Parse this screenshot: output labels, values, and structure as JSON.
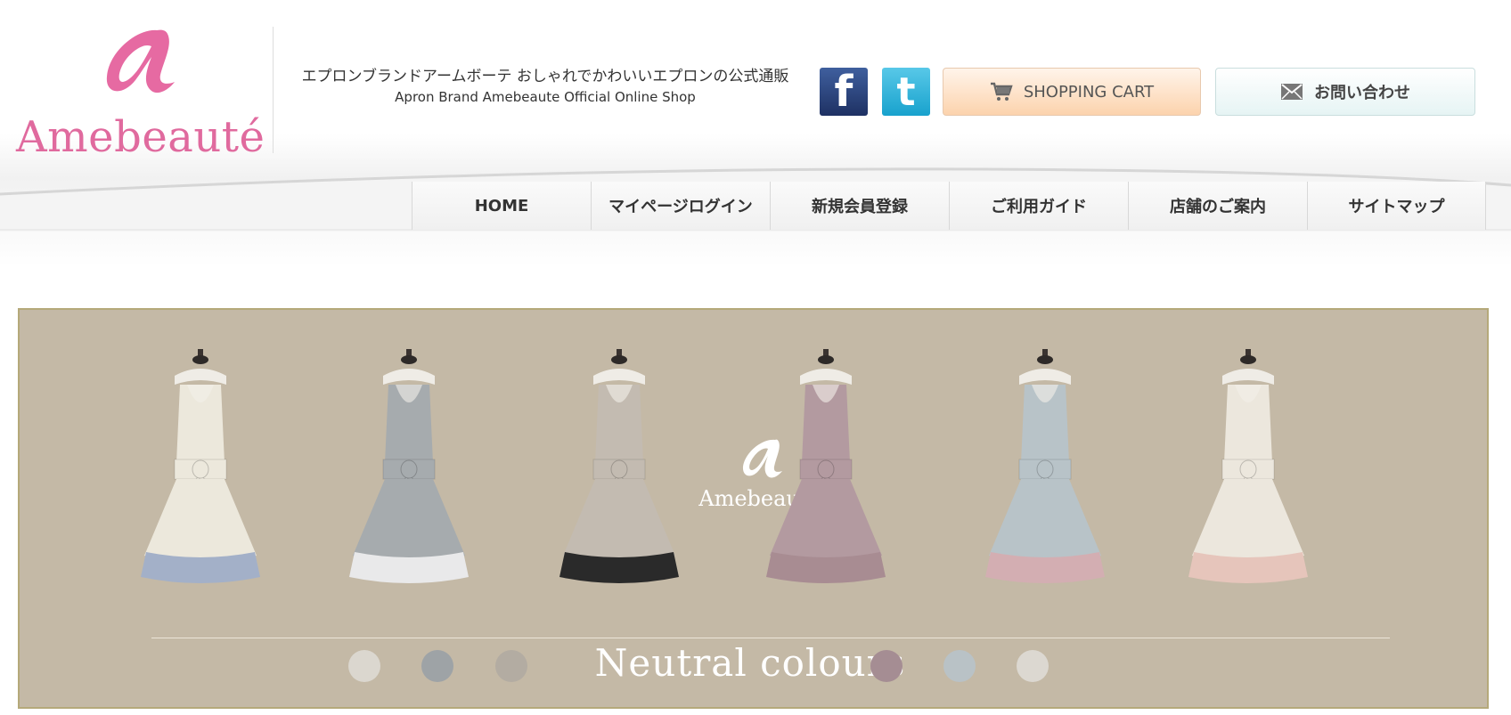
{
  "header": {
    "logo_text": "Amebeauté",
    "tagline_ja": "エプロンブランドアームボーテ おしゃれでかわいいエプロンの公式通販",
    "tagline_en": "Apron Brand Amebeaute Official Online Shop",
    "social": [
      {
        "name": "facebook",
        "glyph": "f"
      },
      {
        "name": "twitter",
        "glyph": "t"
      }
    ],
    "cart_label": "SHOPPING CART",
    "contact_label": "お問い合わせ"
  },
  "nav": {
    "items": [
      {
        "label": "HOME"
      },
      {
        "label": "マイページログイン"
      },
      {
        "label": "新規会員登録"
      },
      {
        "label": "ご利用ガイド"
      },
      {
        "label": "店舗のご案内"
      },
      {
        "label": "サイトマップ"
      }
    ]
  },
  "banner": {
    "logo_text": "Amebeauté",
    "caption": "Neutral colours",
    "background_color": "#c4b9a6",
    "aprons": [
      {
        "body": "#ece8dc",
        "hem": "#a3b0c8"
      },
      {
        "body": "#a6abae",
        "hem": "#e9e9ea"
      },
      {
        "body": "#c3bbb1",
        "hem": "#2a2a2a"
      },
      {
        "body": "#b39aa0",
        "hem": "#a88c92"
      },
      {
        "body": "#b8c3c8",
        "hem": "#d3aeb2"
      },
      {
        "body": "#ece7dd",
        "hem": "#e6c5bb"
      }
    ],
    "swatches_left": [
      "#dbd7cf",
      "#9ea3a6",
      "#b3aca2"
    ],
    "swatches_right": [
      "#a58d93",
      "#b9c2c6",
      "#dcd8d1"
    ]
  }
}
